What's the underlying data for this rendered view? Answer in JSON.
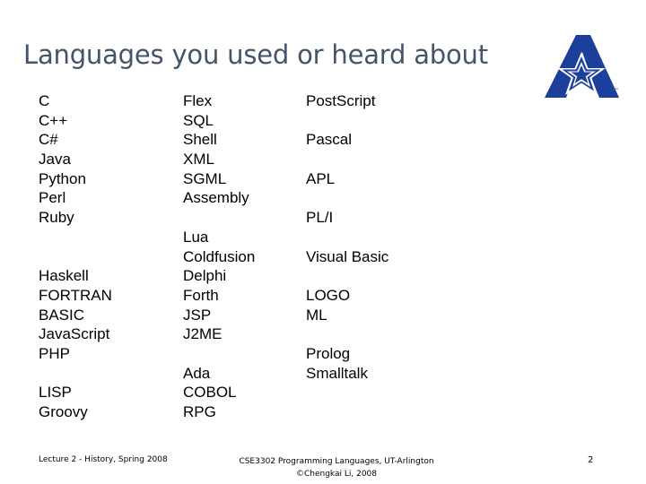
{
  "slide": {
    "title": "Languages you used or heard about",
    "title_color": "#44546A",
    "background_color": "#ffffff",
    "text_color": "#000000",
    "page_number": "2"
  },
  "logo": {
    "name": "uta-a-star-logo",
    "brand_blue": "#1B3F9B",
    "outline_white": "#ffffff",
    "trademark": "™"
  },
  "columns": [
    {
      "name": "column-1",
      "items": [
        "C",
        "C++",
        "C#",
        "Java",
        "Python",
        "Perl",
        "Ruby",
        "",
        "",
        "Haskell",
        "FORTRAN",
        "BASIC",
        "JavaScript",
        "PHP",
        "",
        "LISP",
        "Groovy"
      ]
    },
    {
      "name": "column-2",
      "items": [
        "Flex",
        "SQL",
        "Shell",
        "XML",
        "SGML",
        "Assembly",
        "",
        "Lua",
        "Coldfusion",
        "Delphi",
        "Forth",
        "JSP",
        "J2ME",
        "",
        "Ada",
        "COBOL",
        "RPG"
      ]
    },
    {
      "name": "column-3",
      "items": [
        "PostScript",
        "",
        "Pascal",
        "",
        "APL",
        "",
        "PL/I",
        "",
        "Visual Basic",
        "",
        "LOGO",
        "ML",
        "",
        "Prolog",
        "Smalltalk",
        "",
        ""
      ]
    }
  ],
  "footer": {
    "left": "Lecture 2 - History, Spring 2008",
    "center_line1": "CSE3302 Programming Languages, UT-Arlington",
    "center_line2": "©Chengkai Li, 2008",
    "page_number": "2"
  }
}
